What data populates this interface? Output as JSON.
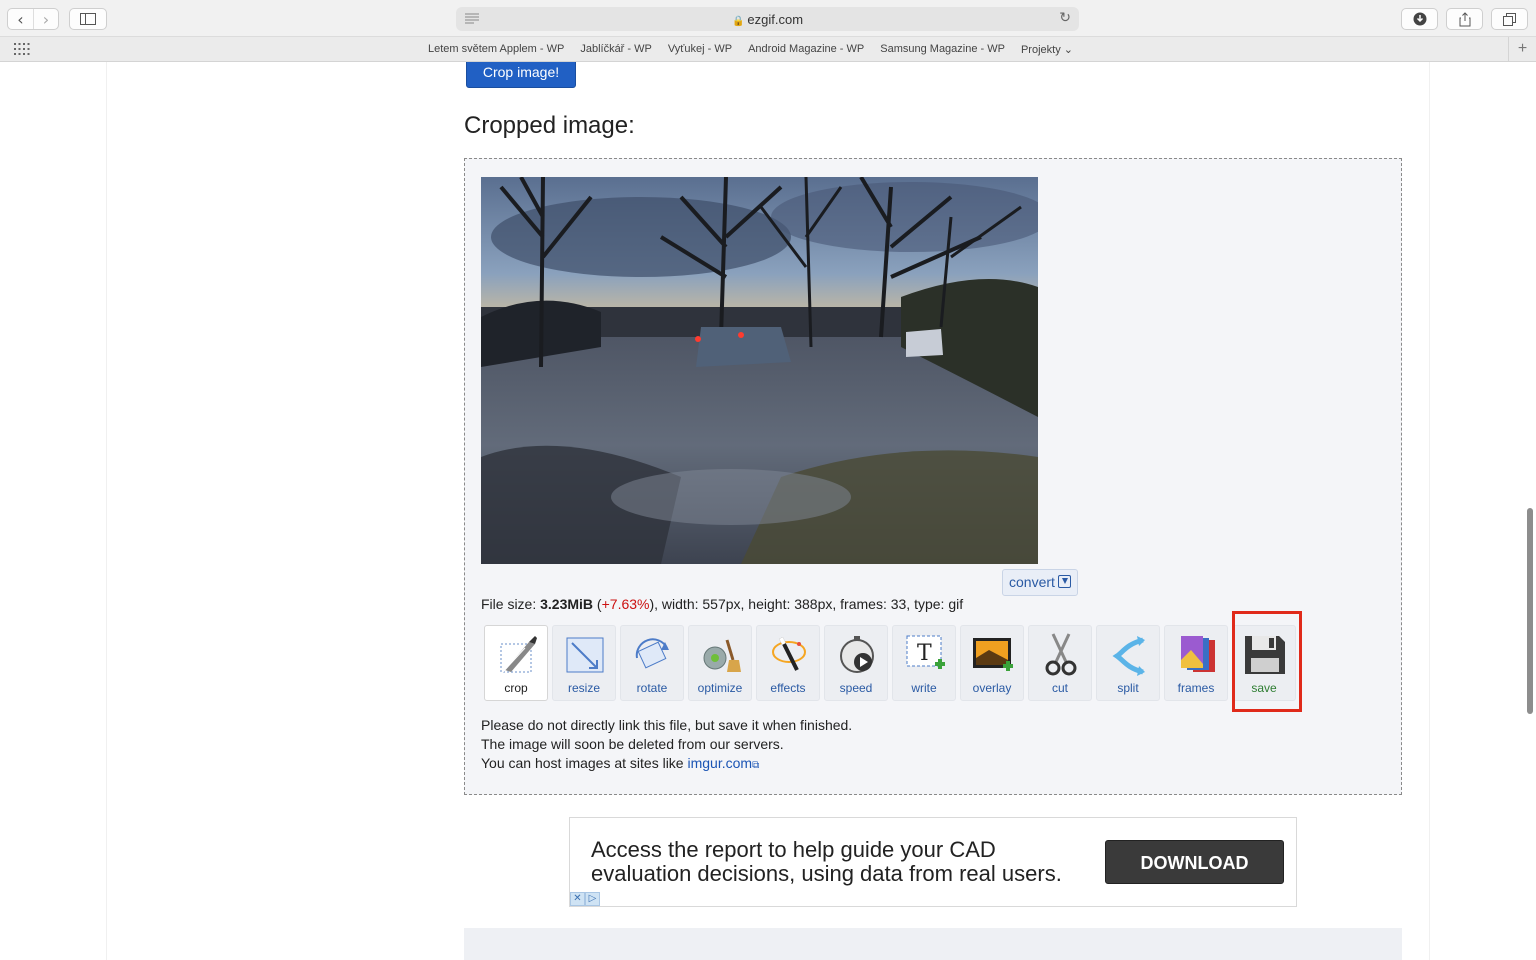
{
  "browser": {
    "url": "ezgif.com",
    "favorites": [
      "Letem světem Applem - WP",
      "Jablíčkář - WP",
      "Vyťukej - WP",
      "Android Magazine - WP",
      "Samsung Magazine - WP",
      "Projekty ⌄"
    ]
  },
  "page": {
    "crop_button": "Crop image!",
    "heading": "Cropped image:",
    "convert_label": "convert",
    "file_info": {
      "prefix": "File size: ",
      "size": "3.23MiB",
      "open_paren": " (",
      "change": "+7.63%",
      "rest": "), width: 557px, height: 388px, frames: 33, type: gif"
    },
    "tools": [
      {
        "label": "crop",
        "icon": "crop-icon"
      },
      {
        "label": "resize",
        "icon": "resize-icon"
      },
      {
        "label": "rotate",
        "icon": "rotate-icon"
      },
      {
        "label": "optimize",
        "icon": "optimize-icon"
      },
      {
        "label": "effects",
        "icon": "effects-icon"
      },
      {
        "label": "speed",
        "icon": "speed-icon"
      },
      {
        "label": "write",
        "icon": "write-icon"
      },
      {
        "label": "overlay",
        "icon": "overlay-icon"
      },
      {
        "label": "cut",
        "icon": "cut-icon"
      },
      {
        "label": "split",
        "icon": "split-icon"
      },
      {
        "label": "frames",
        "icon": "frames-icon"
      },
      {
        "label": "save",
        "icon": "save-icon"
      }
    ],
    "notes": {
      "line1": "Please do not directly link this file, but save it when finished.",
      "line2": "The image will soon be deleted from our servers.",
      "line3_prefix": "You can host images at sites like ",
      "line3_link": "imgur.com"
    }
  },
  "ad": {
    "text": "Access the report to help guide your CAD evaluation decisions, using data from real users.",
    "button": "DOWNLOAD"
  },
  "colors": {
    "accent_blue": "#2160c4",
    "highlight_red": "#e02a1a",
    "percent_red": "#cc1111"
  }
}
